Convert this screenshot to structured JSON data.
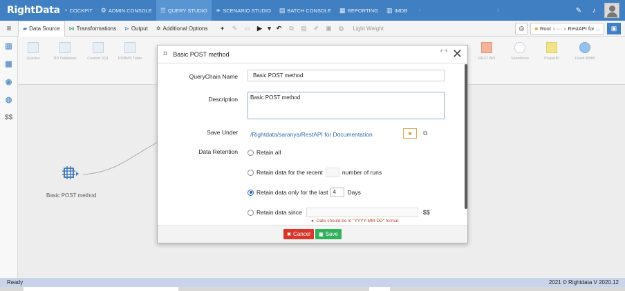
{
  "app": {
    "logo": "RightData"
  },
  "topnav": {
    "items": [
      {
        "label": "COCKPIT",
        "icon": "gauge-icon"
      },
      {
        "label": "ADMIN CONSOLE",
        "icon": "settings-icon"
      },
      {
        "label": "QUERY STUDIO",
        "icon": "list-icon"
      },
      {
        "label": "SCENARIO STUDIO",
        "icon": "nodes-icon"
      },
      {
        "label": "BATCH CONSOLE",
        "icon": "batch-icon"
      },
      {
        "label": "REPORTING",
        "icon": "report-icon"
      },
      {
        "label": "IMDB",
        "icon": "imdb-icon"
      }
    ],
    "active": "QUERY STUDIO"
  },
  "toolbar": {
    "tabs": [
      {
        "label": "Data Source"
      },
      {
        "label": "Transformations"
      },
      {
        "label": "Output"
      },
      {
        "label": "Additional Options"
      }
    ],
    "light_weight": "Light Weight",
    "breadcrumb": {
      "root": "Root",
      "ellipsis": "···",
      "current": "RestAPI for ..."
    }
  },
  "strip": {
    "components": [
      "Queries",
      "RD Database",
      "Custom SQL",
      "RDBMS Table",
      "REST API",
      "Salesforce",
      "ProperBI",
      "Fixed Width"
    ]
  },
  "canvas": {
    "node_label": "Basic POST method"
  },
  "modal": {
    "title": "Basic POST method",
    "querychain_name_label": "QueryChain Name",
    "querychain_name_value": "Basic POST method",
    "description_label": "Description",
    "description_value": "Basic POST method",
    "save_under_label": "Save Under",
    "save_under_path": "/Rightdata/saranya/RestAPI for Documentation",
    "data_retention_label": "Data Retention",
    "options": {
      "retain_all": "Retain all",
      "recent_prefix": "Retain data for the recent",
      "recent_suffix": "number of runs",
      "last_prefix": "Retain data only for the last",
      "last_value": "4",
      "last_suffix": "Days",
      "since_prefix": "Retain data since",
      "since_dollar": "$$"
    },
    "selected_option": "last",
    "date_hint": "Date should be in \"YYYY-MM-DD\" format",
    "cancel_label": "Cancel",
    "save_label": "Save"
  },
  "status": {
    "left": "Ready",
    "right": "2021 © Rightdata V 2020.12"
  }
}
